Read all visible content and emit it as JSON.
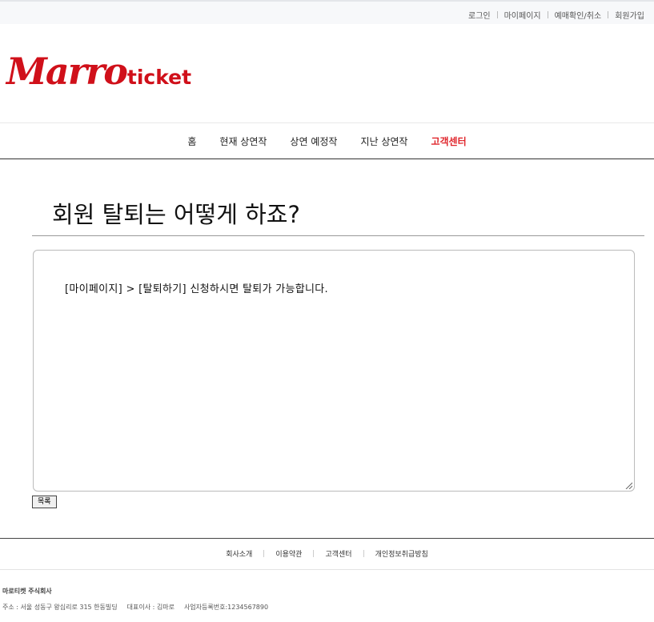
{
  "top_links": [
    "로그인",
    "마이페이지",
    "예매확인/취소",
    "회원가입"
  ],
  "logo": {
    "script": "Marro",
    "word": "ticket",
    "color": "#d0101a"
  },
  "nav": {
    "items": [
      "홈",
      "현재 상연작",
      "상연 예정작",
      "지난 상연작",
      "고객센터"
    ],
    "active_index": 4,
    "active_color": "#e0262c"
  },
  "faq": {
    "question": "회원 탈퇴는 어떻게 하죠?",
    "answer": "[마이페이지] > [탈퇴하기] 신청하시면 탈퇴가 가능합니다.",
    "list_button": "목록"
  },
  "footer": {
    "links": [
      "회사소개",
      "이용약관",
      "고객센터",
      "개인정보취급방침"
    ],
    "company": "마로티켓 주식회사",
    "address": "주소 : 서울 성동구 왕십리로 315 한동빌딩",
    "ceo": "대표이사 : 김마로",
    "biz_no": "사업자등록번호:1234567890"
  }
}
